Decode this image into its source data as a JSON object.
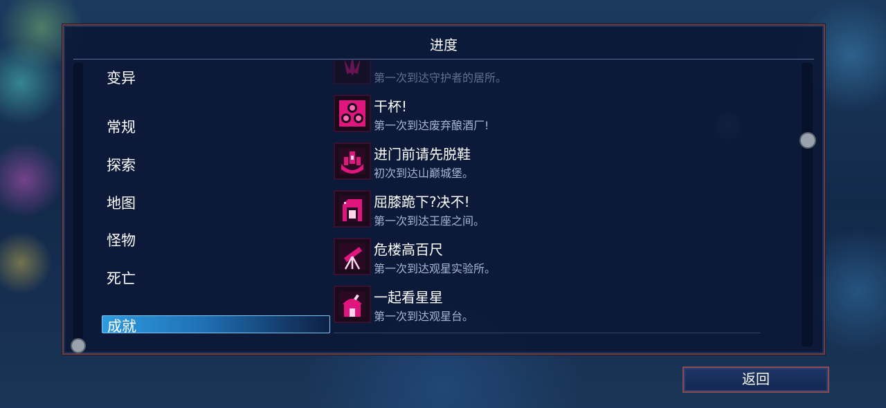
{
  "panel": {
    "title": "进度"
  },
  "categories": [
    {
      "label": "变异"
    },
    {
      "label": "常规"
    },
    {
      "label": "探索"
    },
    {
      "label": "地图"
    },
    {
      "label": "怪物"
    },
    {
      "label": "死亡"
    },
    {
      "label": "成就",
      "selected": true
    }
  ],
  "achievements": [
    {
      "name": "",
      "desc": "第一次到达守护者的居所。",
      "icon": "guardian-icon",
      "partial": true
    },
    {
      "name": "干杯!",
      "desc": "第一次到达废弃酿酒厂!",
      "icon": "barrels-icon"
    },
    {
      "name": "进门前请先脱鞋",
      "desc": "初次到达山巅城堡。",
      "icon": "castle-icon"
    },
    {
      "name": "屈膝跪下?决不!",
      "desc": "第一次到达王座之间。",
      "icon": "throne-icon"
    },
    {
      "name": "危楼高百尺",
      "desc": "第一次到达观星实验所。",
      "icon": "telescope-icon"
    },
    {
      "name": "一起看星星",
      "desc": "第一次到达观星台。",
      "icon": "observatory-icon"
    }
  ],
  "footer": {
    "back_label": "返回"
  },
  "colors": {
    "accent_icon": "#e0157d",
    "selected_tab": "#2f9be0",
    "panel_border": "#6a3f44"
  }
}
